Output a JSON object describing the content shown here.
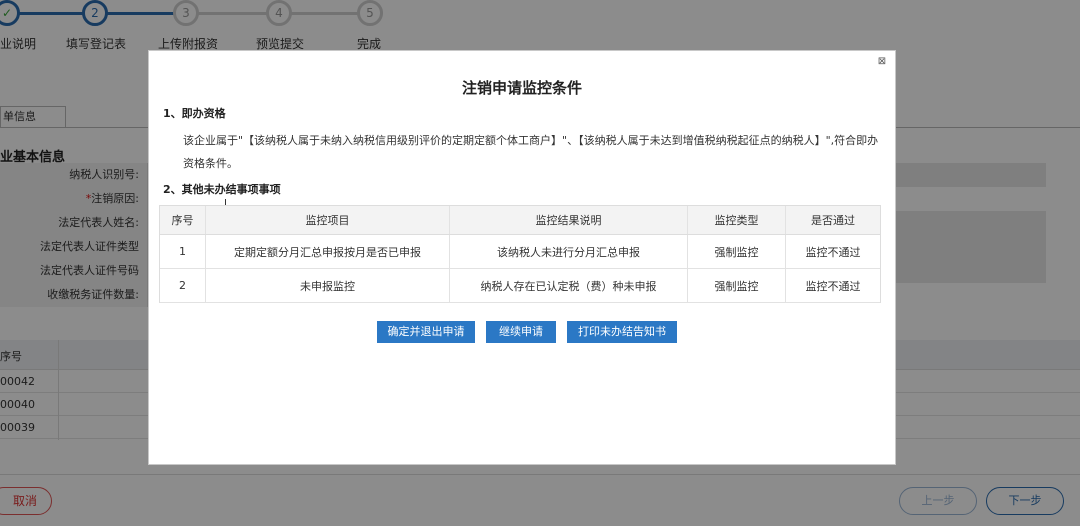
{
  "steps": [
    {
      "num": "✓",
      "label": "业说明"
    },
    {
      "num": "2",
      "label": "填写登记表"
    },
    {
      "num": "3",
      "label": "上传附报资"
    },
    {
      "num": "4",
      "label": "预览提交"
    },
    {
      "num": "5",
      "label": "完成"
    }
  ],
  "background": {
    "tab_label": "单信息",
    "section_title": "业基本信息",
    "form_rows": [
      {
        "label": "纳税人识别号:",
        "required": false
      },
      {
        "label": "注销原因:",
        "required": true
      },
      {
        "label": "法定代表人姓名:",
        "required": false
      },
      {
        "label": "法定代表人证件类型",
        "required": false
      },
      {
        "label": "法定代表人证件号码",
        "required": false
      },
      {
        "label": "收缴税务证件数量:",
        "required": false
      }
    ],
    "table_header": "序号",
    "table_rows": [
      "00042",
      "00040",
      "00039"
    ],
    "cancel_label": "取消",
    "prev_label": "上一步",
    "next_label": "下一步"
  },
  "modal": {
    "close_icon": "⊠",
    "title": "注销申请监控条件",
    "section1_title": "1、即办资格",
    "section1_text": "该企业属于\"【该纳税人属于未纳入纳税信用级别评价的定期定额个体工商户】\"、【该纳税人属于未达到增值税纳税起征点的纳税人】\",符合即办资格条件。",
    "section2_title": "2、其他未办结事项事项",
    "table": {
      "headers": [
        "序号",
        "监控项目",
        "监控结果说明",
        "监控类型",
        "是否通过"
      ],
      "rows": [
        [
          "1",
          "定期定额分月汇总申报按月是否已申报",
          "该纳税人未进行分月汇总申报",
          "强制监控",
          "监控不通过"
        ],
        [
          "2",
          "未申报监控",
          "纳税人存在已认定税（费）种未申报",
          "强制监控",
          "监控不通过"
        ]
      ]
    },
    "buttons": {
      "confirm_exit": "确定并退出申请",
      "continue": "继续申请",
      "print": "打印未办结告知书"
    }
  },
  "colors": {
    "accent": "#2b6cb0",
    "button": "#2b78c5",
    "danger": "#d33333"
  }
}
